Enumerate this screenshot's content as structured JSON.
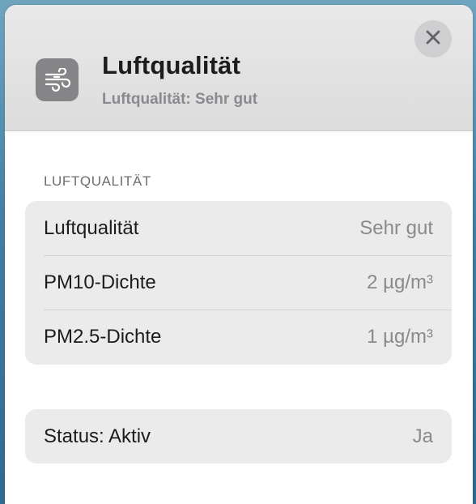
{
  "header": {
    "icon": "wind-icon",
    "title": "Luftqualität",
    "subtitle": "Luftqualität: Sehr gut",
    "close_icon": "close-icon"
  },
  "section": {
    "header": "LUFTQUALITÄT",
    "rows": [
      {
        "label": "Luftqualität",
        "value": "Sehr gut"
      },
      {
        "label": "PM10-Dichte",
        "value": "2 µg/m³"
      },
      {
        "label": "PM2.5-Dichte",
        "value": "1 µg/m³"
      }
    ]
  },
  "status": {
    "label": "Status: Aktiv",
    "value": "Ja"
  }
}
